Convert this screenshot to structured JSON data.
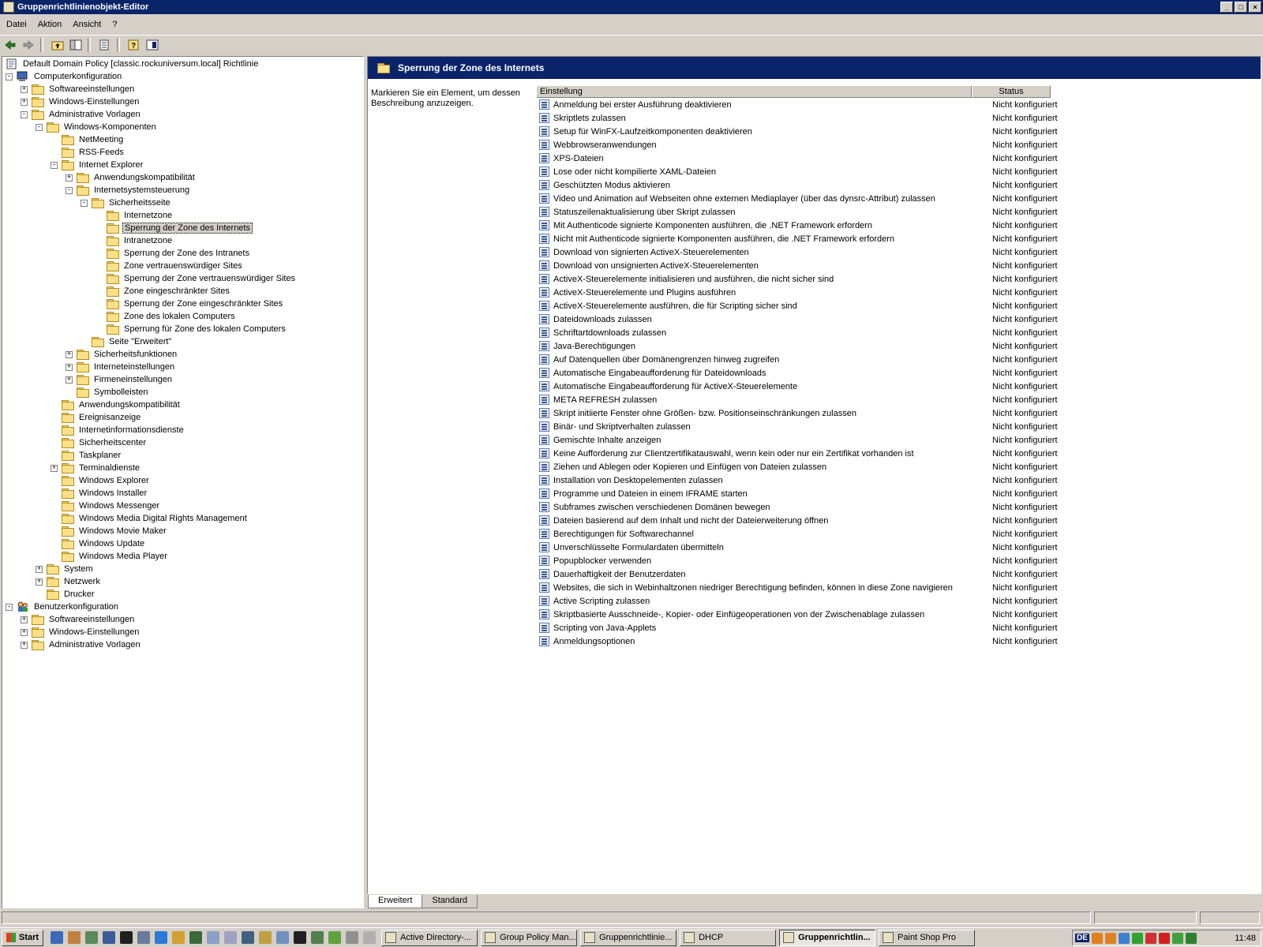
{
  "window": {
    "title": "Gruppenrichtlinienobjekt-Editor",
    "buttons": [
      "_",
      "□",
      "×"
    ]
  },
  "menu": [
    "Datei",
    "Aktion",
    "Ansicht",
    "?"
  ],
  "toolbar_icons": [
    "back-icon",
    "forward-icon",
    "up-folder-icon",
    "show-hide-tree-icon",
    "export-list-icon",
    "help-icon",
    "properties-icon"
  ],
  "tree": [
    {
      "label": "Default Domain Policy [classic.rockuniversum.local] Richtlinie",
      "level": 0,
      "expander": "",
      "icon": "policy"
    },
    {
      "label": "Computerkonfiguration",
      "level": 0,
      "expander": "-",
      "icon": "computer"
    },
    {
      "label": "Softwareeinstellungen",
      "level": 1,
      "expander": "+",
      "icon": "folder"
    },
    {
      "label": "Windows-Einstellungen",
      "level": 1,
      "expander": "+",
      "icon": "folder"
    },
    {
      "label": "Administrative Vorlagen",
      "level": 1,
      "expander": "-",
      "icon": "folder"
    },
    {
      "label": "Windows-Komponenten",
      "level": 2,
      "expander": "-",
      "icon": "folder"
    },
    {
      "label": "NetMeeting",
      "level": 3,
      "expander": "",
      "icon": "folder"
    },
    {
      "label": "RSS-Feeds",
      "level": 3,
      "expander": "",
      "icon": "folder"
    },
    {
      "label": "Internet Explorer",
      "level": 3,
      "expander": "-",
      "icon": "folder"
    },
    {
      "label": "Anwendungskompatibilität",
      "level": 4,
      "expander": "+",
      "icon": "folder"
    },
    {
      "label": "Internetsystemsteuerung",
      "level": 4,
      "expander": "-",
      "icon": "folder"
    },
    {
      "label": "Sicherheitsseite",
      "level": 5,
      "expander": "-",
      "icon": "folder"
    },
    {
      "label": "Internetzone",
      "level": 6,
      "expander": "",
      "icon": "folder"
    },
    {
      "label": "Sperrung der Zone des Internets",
      "level": 6,
      "expander": "",
      "icon": "folder",
      "selected": true
    },
    {
      "label": "Intranetzone",
      "level": 6,
      "expander": "",
      "icon": "folder"
    },
    {
      "label": "Sperrung der Zone des Intranets",
      "level": 6,
      "expander": "",
      "icon": "folder"
    },
    {
      "label": "Zone vertrauenswürdiger Sites",
      "level": 6,
      "expander": "",
      "icon": "folder"
    },
    {
      "label": "Sperrung der Zone vertrauenswürdiger Sites",
      "level": 6,
      "expander": "",
      "icon": "folder"
    },
    {
      "label": "Zone eingeschränkter Sites",
      "level": 6,
      "expander": "",
      "icon": "folder"
    },
    {
      "label": "Sperrung der Zone eingeschränkter Sites",
      "level": 6,
      "expander": "",
      "icon": "folder"
    },
    {
      "label": "Zone des lokalen Computers",
      "level": 6,
      "expander": "",
      "icon": "folder"
    },
    {
      "label": "Sperrung für Zone des lokalen Computers",
      "level": 6,
      "expander": "",
      "icon": "folder"
    },
    {
      "label": "Seite \"Erweitert\"",
      "level": 5,
      "expander": "",
      "icon": "folder"
    },
    {
      "label": "Sicherheitsfunktionen",
      "level": 4,
      "expander": "+",
      "icon": "folder"
    },
    {
      "label": "Interneteinstellungen",
      "level": 4,
      "expander": "+",
      "icon": "folder"
    },
    {
      "label": "Firmeneinstellungen",
      "level": 4,
      "expander": "+",
      "icon": "folder"
    },
    {
      "label": "Symbolleisten",
      "level": 4,
      "expander": "",
      "icon": "folder"
    },
    {
      "label": "Anwendungskompatibilität",
      "level": 3,
      "expander": "",
      "icon": "folder"
    },
    {
      "label": "Ereignisanzeige",
      "level": 3,
      "expander": "",
      "icon": "folder"
    },
    {
      "label": "Internetinformationsdienste",
      "level": 3,
      "expander": "",
      "icon": "folder"
    },
    {
      "label": "Sicherheitscenter",
      "level": 3,
      "expander": "",
      "icon": "folder"
    },
    {
      "label": "Taskplaner",
      "level": 3,
      "expander": "",
      "icon": "folder"
    },
    {
      "label": "Terminaldienste",
      "level": 3,
      "expander": "+",
      "icon": "folder"
    },
    {
      "label": "Windows Explorer",
      "level": 3,
      "expander": "",
      "icon": "folder"
    },
    {
      "label": "Windows Installer",
      "level": 3,
      "expander": "",
      "icon": "folder"
    },
    {
      "label": "Windows Messenger",
      "level": 3,
      "expander": "",
      "icon": "folder"
    },
    {
      "label": "Windows Media Digital Rights Management",
      "level": 3,
      "expander": "",
      "icon": "folder"
    },
    {
      "label": "Windows Movie Maker",
      "level": 3,
      "expander": "",
      "icon": "folder"
    },
    {
      "label": "Windows Update",
      "level": 3,
      "expander": "",
      "icon": "folder"
    },
    {
      "label": "Windows Media Player",
      "level": 3,
      "expander": "",
      "icon": "folder"
    },
    {
      "label": "System",
      "level": 2,
      "expander": "+",
      "icon": "folder"
    },
    {
      "label": "Netzwerk",
      "level": 2,
      "expander": "+",
      "icon": "folder"
    },
    {
      "label": "Drucker",
      "level": 2,
      "expander": "",
      "icon": "folder"
    },
    {
      "label": "Benutzerkonfiguration",
      "level": 0,
      "expander": "-",
      "icon": "users"
    },
    {
      "label": "Softwareeinstellungen",
      "level": 1,
      "expander": "+",
      "icon": "folder"
    },
    {
      "label": "Windows-Einstellungen",
      "level": 1,
      "expander": "+",
      "icon": "folder"
    },
    {
      "label": "Administrative Vorlagen",
      "level": 1,
      "expander": "+",
      "icon": "folder"
    }
  ],
  "right": {
    "header": "Sperrung der Zone des Internets",
    "description": "Markieren Sie ein Element, um dessen Beschreibung anzuzeigen.",
    "columns": {
      "setting": "Einstellung",
      "status": "Status"
    },
    "rows": [
      {
        "name": "Anmeldung bei erster Ausführung deaktivieren",
        "status": "Nicht konfiguriert"
      },
      {
        "name": "Skriptlets zulassen",
        "status": "Nicht konfiguriert"
      },
      {
        "name": "Setup für WinFX-Laufzeitkomponenten deaktivieren",
        "status": "Nicht konfiguriert"
      },
      {
        "name": "Webbrowseranwendungen",
        "status": "Nicht konfiguriert"
      },
      {
        "name": "XPS-Dateien",
        "status": "Nicht konfiguriert"
      },
      {
        "name": "Lose oder nicht kompilierte XAML-Dateien",
        "status": "Nicht konfiguriert"
      },
      {
        "name": "Geschützten Modus aktivieren",
        "status": "Nicht konfiguriert"
      },
      {
        "name": "Video und Animation auf Webseiten ohne externen Mediaplayer (über das dynsrc-Attribut) zulassen",
        "status": "Nicht konfiguriert"
      },
      {
        "name": "Statuszeilenaktualisierung über Skript zulassen",
        "status": "Nicht konfiguriert"
      },
      {
        "name": "Mit Authenticode signierte Komponenten ausführen, die .NET Framework erfordern",
        "status": "Nicht konfiguriert"
      },
      {
        "name": "Nicht mit Authenticode signierte Komponenten ausführen, die .NET Framework erfordern",
        "status": "Nicht konfiguriert"
      },
      {
        "name": "Download von signierten ActiveX-Steuerelementen",
        "status": "Nicht konfiguriert"
      },
      {
        "name": "Download von unsignierten ActiveX-Steuerelementen",
        "status": "Nicht konfiguriert"
      },
      {
        "name": "ActiveX-Steuerelemente initialisieren und ausführen, die nicht sicher sind",
        "status": "Nicht konfiguriert"
      },
      {
        "name": "ActiveX-Steuerelemente und Plugins ausführen",
        "status": "Nicht konfiguriert"
      },
      {
        "name": "ActiveX-Steuerelemente ausführen, die für Scripting sicher sind",
        "status": "Nicht konfiguriert"
      },
      {
        "name": "Dateidownloads zulassen",
        "status": "Nicht konfiguriert"
      },
      {
        "name": "Schriftartdownloads zulassen",
        "status": "Nicht konfiguriert"
      },
      {
        "name": "Java-Berechtigungen",
        "status": "Nicht konfiguriert"
      },
      {
        "name": "Auf Datenquellen über Domänengrenzen hinweg zugreifen",
        "status": "Nicht konfiguriert"
      },
      {
        "name": "Automatische Eingabeaufforderung für Dateidownloads",
        "status": "Nicht konfiguriert"
      },
      {
        "name": "Automatische Eingabeaufforderung für ActiveX-Steuerelemente",
        "status": "Nicht konfiguriert"
      },
      {
        "name": "META REFRESH zulassen",
        "status": "Nicht konfiguriert"
      },
      {
        "name": "Skript initiierte Fenster ohne Größen- bzw. Positionseinschränkungen zulassen",
        "status": "Nicht konfiguriert"
      },
      {
        "name": "Binär- und Skriptverhalten zulassen",
        "status": "Nicht konfiguriert"
      },
      {
        "name": "Gemischte Inhalte anzeigen",
        "status": "Nicht konfiguriert"
      },
      {
        "name": "Keine Aufforderung zur Clientzertifikatauswahl, wenn kein oder nur ein Zertifikat vorhanden ist",
        "status": "Nicht konfiguriert"
      },
      {
        "name": "Ziehen und Ablegen oder Kopieren und Einfügen von Dateien zulassen",
        "status": "Nicht konfiguriert"
      },
      {
        "name": "Installation von Desktopelementen zulassen",
        "status": "Nicht konfiguriert"
      },
      {
        "name": "Programme und Dateien in einem IFRAME starten",
        "status": "Nicht konfiguriert"
      },
      {
        "name": "Subframes zwischen verschiedenen Domänen bewegen",
        "status": "Nicht konfiguriert"
      },
      {
        "name": "Dateien basierend auf dem Inhalt und nicht der Dateierweiterung öffnen",
        "status": "Nicht konfiguriert"
      },
      {
        "name": "Berechtigungen für Softwarechannel",
        "status": "Nicht konfiguriert"
      },
      {
        "name": "Unverschlüsselte Formulardaten übermitteln",
        "status": "Nicht konfiguriert"
      },
      {
        "name": "Popupblocker verwenden",
        "status": "Nicht konfiguriert"
      },
      {
        "name": "Dauerhaftigkeit der Benutzerdaten",
        "status": "Nicht konfiguriert"
      },
      {
        "name": "Websites, die sich in Webinhaltzonen niedriger Berechtigung befinden, können in diese Zone navigieren",
        "status": "Nicht konfiguriert"
      },
      {
        "name": "Active Scripting zulassen",
        "status": "Nicht konfiguriert"
      },
      {
        "name": "Skriptbasierte Ausschneide-, Kopier- oder Einfügeoperationen von der Zwischenablage zulassen",
        "status": "Nicht konfiguriert"
      },
      {
        "name": "Scripting von Java-Applets",
        "status": "Nicht konfiguriert"
      },
      {
        "name": "Anmeldungsoptionen",
        "status": "Nicht konfiguriert"
      }
    ],
    "tabs": [
      "Erweitert",
      "Standard"
    ],
    "active_tab": "Erweitert"
  },
  "taskbar": {
    "start": "Start",
    "tasks": [
      {
        "label": "Active Directory-...",
        "active": false
      },
      {
        "label": "Group Policy Man...",
        "active": false
      },
      {
        "label": "Gruppenrichtlinie...",
        "active": false
      },
      {
        "label": "DHCP",
        "active": false
      },
      {
        "label": "Gruppenrichtlin...",
        "active": true
      },
      {
        "label": "Paint Shop Pro",
        "active": false
      }
    ],
    "language": "DE",
    "clock": "11:48"
  },
  "colors": {
    "titlebar": "#0a246a",
    "face": "#d4d0c8",
    "folder": "#fce089"
  }
}
